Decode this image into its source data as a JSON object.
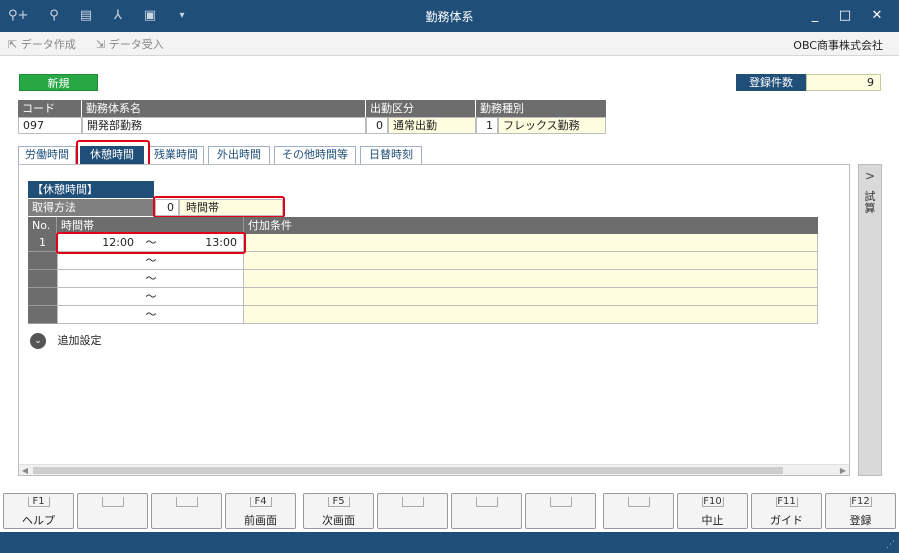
{
  "window": {
    "title": "勤務体系",
    "toolbar_icons": [
      "search-plus-icon",
      "search-doc-icon",
      "print-icon",
      "compass-icon",
      "doc-check-icon",
      "dropdown-icon"
    ],
    "minimize": "_",
    "maximize": "□",
    "close": "✕"
  },
  "toolbar": {
    "create_data": "データ作成",
    "receive_data": "データ受入",
    "company": "OBC商事株式会社"
  },
  "mode_badge": "新規",
  "record_count": {
    "label": "登録件数",
    "value": "9"
  },
  "header": {
    "code_label": "コード",
    "name_label": "勤務体系名",
    "attendance_label": "出勤区分",
    "worktype_label": "勤務種別",
    "code": "097",
    "name": "開発部勤務",
    "attendance_code": "0",
    "attendance_name": "通常出勤",
    "worktype_code": "1",
    "worktype_name": "フレックス勤務"
  },
  "tabs": [
    "労働時間",
    "休憩時間",
    "残業時間",
    "外出時間",
    "その他時間等",
    "日替時刻"
  ],
  "active_tab": "休憩時間",
  "section_title": "【休憩時間】",
  "method": {
    "label": "取得方法",
    "code": "0",
    "name": "時間帯"
  },
  "grid": {
    "col_no": "No.",
    "col_time": "時間帯",
    "col_cond": "付加条件",
    "separator": "～",
    "rows": [
      {
        "no": "1",
        "start": "12:00",
        "end": "13:00"
      },
      {
        "no": "",
        "start": "",
        "end": ""
      },
      {
        "no": "",
        "start": "",
        "end": ""
      },
      {
        "no": "",
        "start": "",
        "end": ""
      },
      {
        "no": "",
        "start": "",
        "end": ""
      }
    ]
  },
  "additional_settings": "追加設定",
  "side_panel": {
    "arrow": ">",
    "label": "試算"
  },
  "fkeys": [
    {
      "key": "F1",
      "label": "ヘルプ"
    },
    {
      "key": "",
      "label": ""
    },
    {
      "key": "",
      "label": ""
    },
    {
      "key": "F4",
      "label": "前画面"
    },
    {
      "key": "F5",
      "label": "次画面"
    },
    {
      "key": "",
      "label": ""
    },
    {
      "key": "",
      "label": ""
    },
    {
      "key": "",
      "label": ""
    },
    {
      "key": "",
      "label": ""
    },
    {
      "key": "F10",
      "label": "中止"
    },
    {
      "key": "F11",
      "label": "ガイド"
    },
    {
      "key": "F12",
      "label": "登録"
    }
  ]
}
